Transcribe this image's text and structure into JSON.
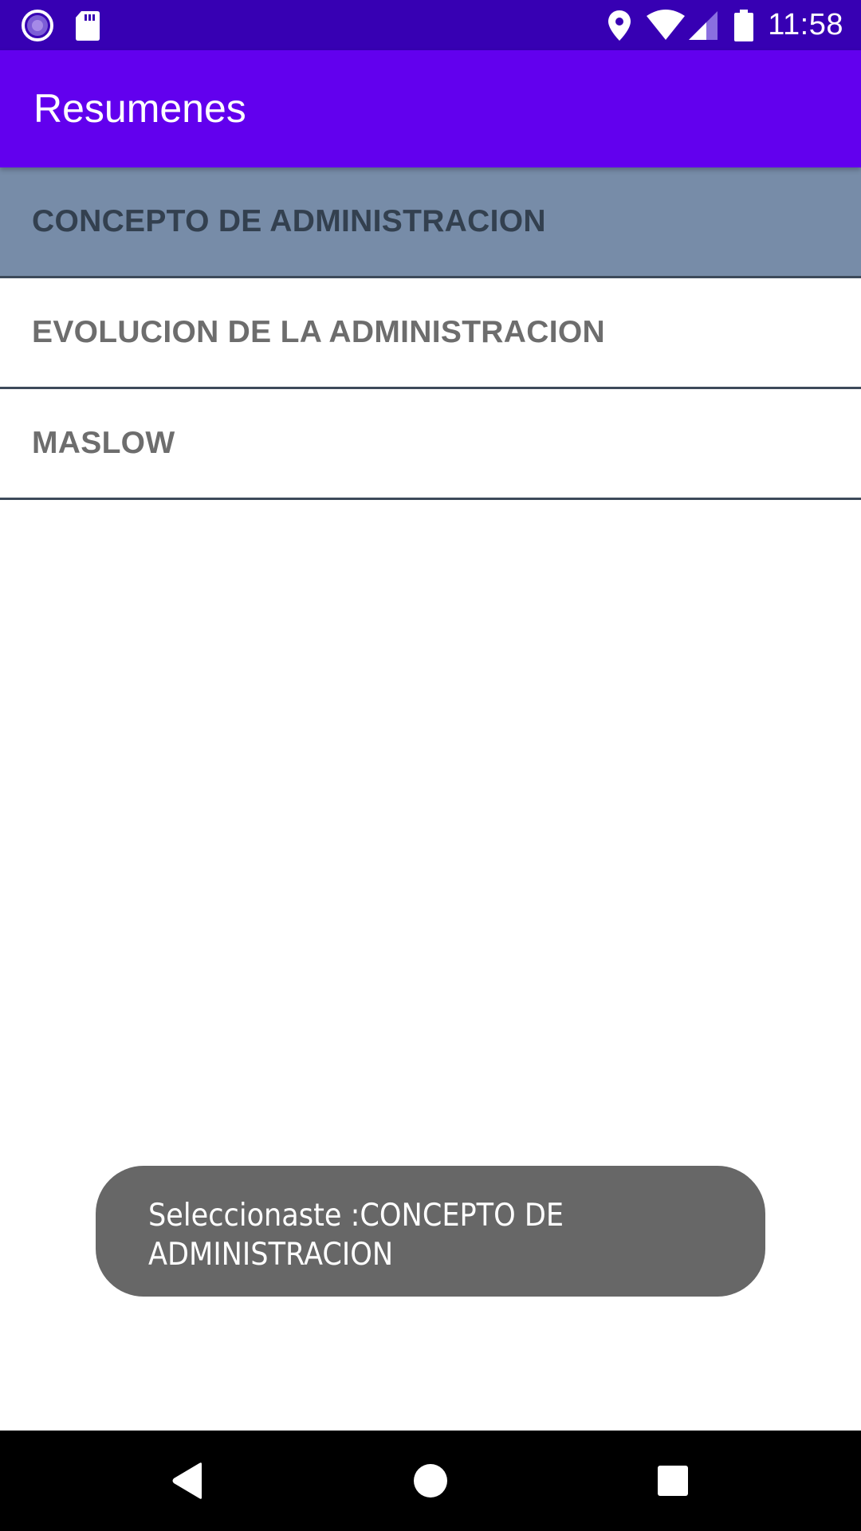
{
  "status_bar": {
    "time": "11:58",
    "icons": [
      "podcast-icon",
      "sd-card-icon",
      "location-icon",
      "wifi-icon",
      "signal-icon",
      "battery-icon"
    ]
  },
  "app_bar": {
    "title": "Resumenes"
  },
  "list": {
    "items": [
      {
        "label": "CONCEPTO DE ADMINISTRACION",
        "selected": true
      },
      {
        "label": "EVOLUCION DE LA ADMINISTRACION",
        "selected": false
      },
      {
        "label": "MASLOW",
        "selected": false
      }
    ]
  },
  "toast": {
    "message": "Seleccionaste :CONCEPTO DE ADMINISTRACION"
  },
  "nav_bar": {
    "icons": [
      "back-icon",
      "home-icon",
      "recents-icon"
    ]
  },
  "colors": {
    "status_bar": "#3700b3",
    "app_bar": "#6200ee",
    "selected_item": "#778ca8",
    "toast": "#676767"
  }
}
